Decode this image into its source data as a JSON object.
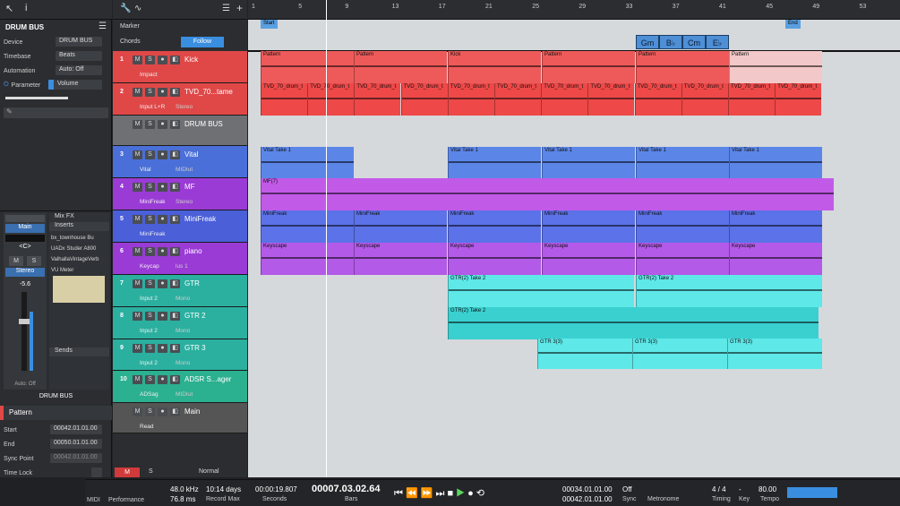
{
  "inspector": {
    "track_name": "DRUM BUS",
    "device_label": "Device",
    "device_val": "DRUM BUS",
    "timebase_label": "Timebase",
    "timebase_val": "Beats",
    "automation_label": "Automation",
    "automation_val": "Auto: Off",
    "parameter_label": "Parameter",
    "parameter_val": "Volume",
    "mix_fx": "Mix FX",
    "main": "Main",
    "pan": "<C>",
    "stereo": "Stereo",
    "fader_val": "-5.6",
    "auto_off": "Auto: Off",
    "bus_label": "DRUM BUS",
    "inserts": "Inserts",
    "sends": "Sends",
    "insert_items": [
      "bx_townhouse Bu",
      "UADx Studer A800",
      "ValhallaVintageVerb",
      "VU Meter"
    ],
    "event_title": "Pattern",
    "start_label": "Start",
    "start_val": "00042.01.01.00",
    "end_label": "End",
    "end_val": "00050.01.01.00",
    "sync_label": "Sync Point",
    "sync_val": "00042.01.01.00",
    "timelock_label": "Time Lock"
  },
  "header": {
    "marker": "Marker",
    "chords": "Chords",
    "follow": "Follow"
  },
  "tracks": [
    {
      "num": "1",
      "name": "Kick",
      "sub": "Impact",
      "color": "#e04848"
    },
    {
      "num": "2",
      "name": "TVD_70...tame",
      "sub": "Input L+R",
      "sub2": "Stereo",
      "color": "#e04848"
    },
    {
      "num": "",
      "name": "DRUM BUS",
      "sub": "",
      "color": "#6e7074"
    },
    {
      "num": "3",
      "name": "Vital",
      "sub": "Vital",
      "sub2": "MIDIut",
      "color": "#4a6fd8"
    },
    {
      "num": "4",
      "name": "MF",
      "sub": "MiniFreak",
      "sub2": "Stereo",
      "color": "#9a3bd6"
    },
    {
      "num": "5",
      "name": "MiniFreak",
      "sub": "MiniFreak",
      "color": "#4a5fd8"
    },
    {
      "num": "6",
      "name": "piano",
      "sub": "Keycap",
      "sub2": "lus 1",
      "color": "#9a3bd6"
    },
    {
      "num": "7",
      "name": "GTR",
      "sub": "Input 2",
      "sub2": "Mono",
      "color": "#2bb0a0"
    },
    {
      "num": "8",
      "name": "GTR 2",
      "sub": "Input 2",
      "sub2": "Mono",
      "color": "#2bb0a0"
    },
    {
      "num": "9",
      "name": "GTR 3",
      "sub": "Input 2",
      "sub2": "Mono",
      "color": "#2bb0a0"
    },
    {
      "num": "10",
      "name": "ADSR S...ager",
      "sub": "ADSag",
      "sub2": "MIDIut",
      "color": "#2bb090"
    },
    {
      "num": "",
      "name": "Main",
      "sub": "Read",
      "color": "#555"
    }
  ],
  "ruler": [
    "1",
    "5",
    "9",
    "13",
    "17",
    "21",
    "25",
    "29",
    "33",
    "37",
    "41",
    "45",
    "49",
    "53"
  ],
  "markers": {
    "start": "Start",
    "end": "End"
  },
  "chords": [
    "Gm",
    "B♭",
    "Cm",
    "E♭"
  ],
  "clips": {
    "pattern": "Pattern",
    "kick": "Kick",
    "tvd": "TVD_70_drum_t",
    "vital": "Vital Take 1",
    "mf": "MF(7)",
    "minifreak": "MiniFreak",
    "keyscape": "Keyscape",
    "gtr": "GTR(2) Take 2",
    "gtr3": "GTR 3(3)",
    "gtr_chords": [
      "Gm",
      "B♭",
      "Cm",
      "E♭"
    ]
  },
  "footer": {
    "m": "M",
    "s": "S",
    "normal": "Normal"
  },
  "transport": {
    "midi": "MIDI",
    "performance": "Performance",
    "rate": "48.0 kHz",
    "latency": "76.8 ms",
    "days": "10:14 days",
    "record_max": "Record Max",
    "seconds_val": "00:00:19.807",
    "seconds": "Seconds",
    "bars_val": "00007.03.02.64",
    "bars": "Bars",
    "l_val": "00034.01.01.00",
    "r_val": "00042.01.01.00",
    "sync_val": "Off",
    "sync": "Sync",
    "metronome": "Metronome",
    "timing": "Timing",
    "timing_val": "4 / 4",
    "key": "Key",
    "key_val": "-",
    "tempo": "Tempo",
    "tempo_val": "80.00"
  }
}
